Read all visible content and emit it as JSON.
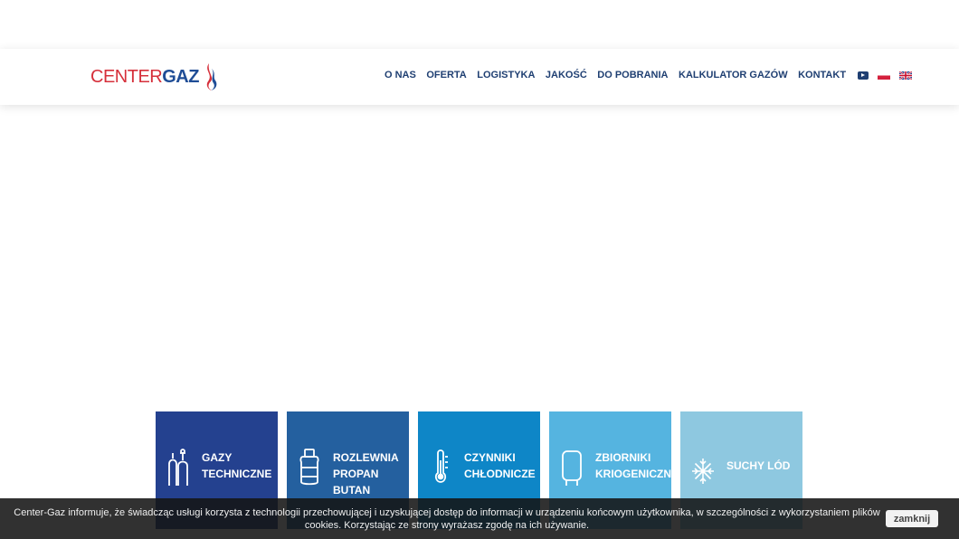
{
  "header": {
    "logo": {
      "part1": "CENTER",
      "part2": "GAZ"
    },
    "nav": [
      {
        "label": "O NAS"
      },
      {
        "label": "OFERTA"
      },
      {
        "label": "LOGISTYKA"
      },
      {
        "label": "JAKOŚĆ"
      },
      {
        "label": "DO POBRANIA"
      },
      {
        "label": "KALKULATOR GAZÓW"
      },
      {
        "label": "KONTAKT"
      }
    ],
    "icons": [
      "youtube-icon",
      "polish-flag-icon",
      "uk-flag-icon"
    ]
  },
  "tiles": [
    {
      "label": "GAZY\nTECHNICZNE",
      "icon": "gas-cylinders-icon",
      "color": "#24418f"
    },
    {
      "label": "ROZLEWNIA\nPROPAN\nBUTAN",
      "icon": "propane-tank-icon",
      "color": "#24609f"
    },
    {
      "label": "CZYNNIKI\nCHŁODNICZE",
      "icon": "thermometer-icon",
      "color": "#0e86c7"
    },
    {
      "label": "ZBIORNIKI\nKRIOGENICZNE",
      "icon": "cryo-tank-icon",
      "color": "#55b4e0"
    },
    {
      "label": "SUCHY LÓD",
      "icon": "snowflake-icon",
      "color": "#8ec8e0"
    }
  ],
  "cookie": {
    "text": "Center-Gaz informuje, że świadcząc usługi korzysta z technologii przechowującej i uzyskującej dostęp do informacji w urządzeniu końcowym użytkownika, w szczególności z wykorzystaniem plików cookies. Korzystając ze strony wyrażasz zgodę na ich używanie.",
    "button": "zamknij"
  }
}
